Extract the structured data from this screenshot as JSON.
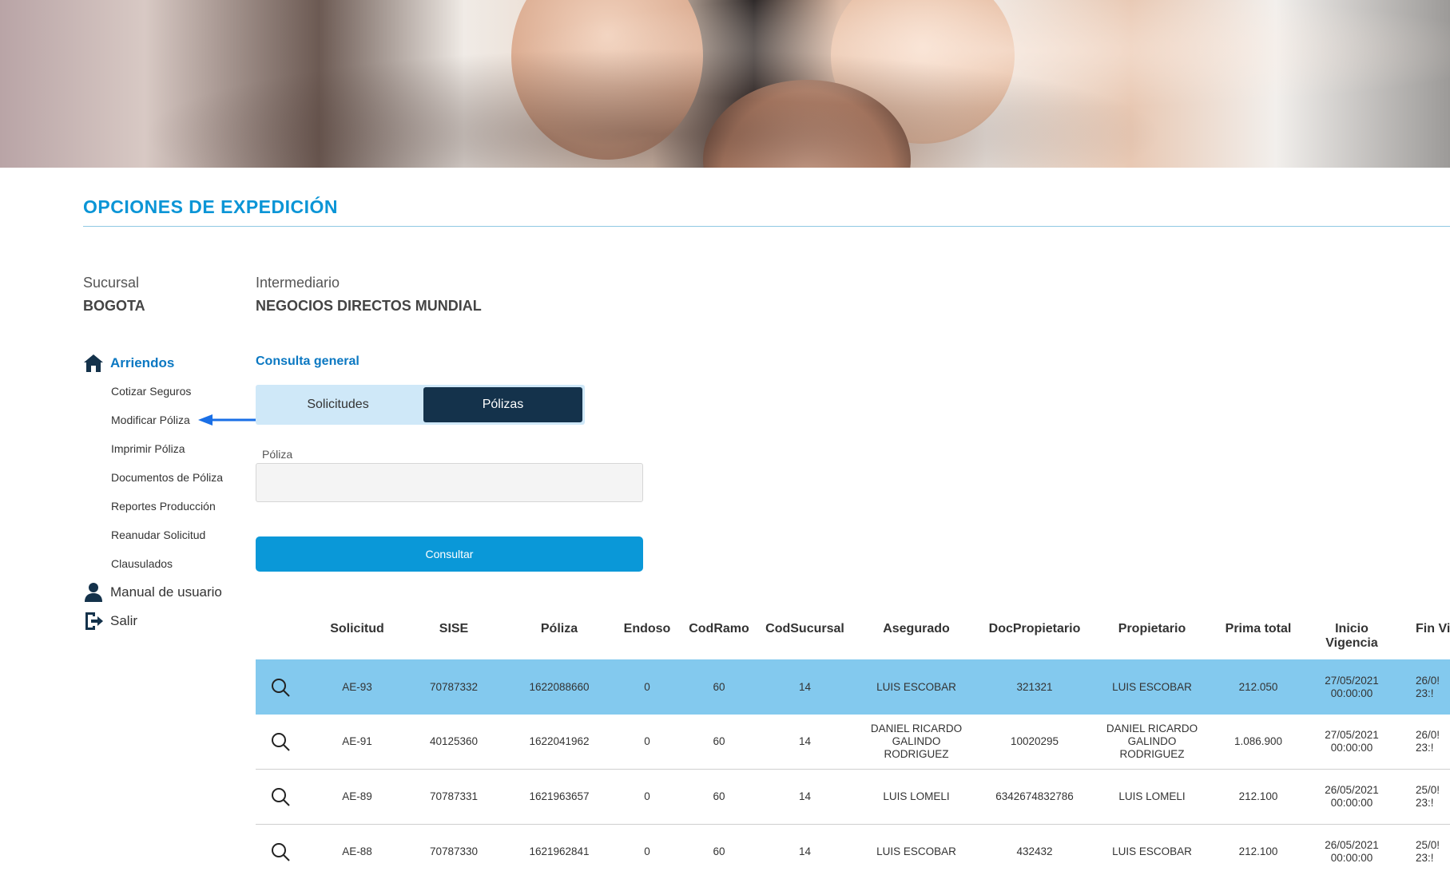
{
  "page": {
    "title": "OPCIONES DE EXPEDICIÓN"
  },
  "meta": {
    "sucursal_label": "Sucursal",
    "sucursal_value": "BOGOTA",
    "intermediario_label": "Intermediario",
    "intermediario_value": "NEGOCIOS DIRECTOS MUNDIAL"
  },
  "sidebar": {
    "section": {
      "label": "Arriendos",
      "icon": "home-icon"
    },
    "items": [
      {
        "label": "Cotizar Seguros"
      },
      {
        "label": "Modificar Póliza"
      },
      {
        "label": "Imprimir Póliza"
      },
      {
        "label": "Documentos de Póliza"
      },
      {
        "label": "Reportes Producción"
      },
      {
        "label": "Reanudar Solicitud"
      },
      {
        "label": "Clausulados"
      }
    ],
    "manual": {
      "label": "Manual de usuario",
      "icon": "user-icon"
    },
    "exit": {
      "label": "Salir",
      "icon": "logout-icon"
    }
  },
  "consulta": {
    "title": "Consulta general",
    "tabs": [
      {
        "label": "Solicitudes",
        "active": false
      },
      {
        "label": "Pólizas",
        "active": true
      }
    ],
    "field_label": "Póliza",
    "field_value": "",
    "button_label": "Consultar"
  },
  "table": {
    "headers": [
      "Solicitud",
      "SISE",
      "Póliza",
      "Endoso",
      "CodRamo",
      "CodSucursal",
      "Asegurado",
      "DocPropietario",
      "Propietario",
      "Prima total",
      "Inicio Vigencia",
      "Fin Vi"
    ],
    "rows": [
      {
        "selected": true,
        "cells": [
          "AE-93",
          "70787332",
          "1622088660",
          "0",
          "60",
          "14",
          "LUIS ESCOBAR",
          "321321",
          "LUIS ESCOBAR",
          "212.050",
          "27/05/2021 00:00:00",
          "26/0! 23:!"
        ]
      },
      {
        "selected": false,
        "cells": [
          "AE-91",
          "40125360",
          "1622041962",
          "0",
          "60",
          "14",
          "DANIEL RICARDO GALINDO RODRIGUEZ",
          "10020295",
          "DANIEL RICARDO GALINDO RODRIGUEZ",
          "1.086.900",
          "27/05/2021 00:00:00",
          "26/0! 23:!"
        ]
      },
      {
        "selected": false,
        "cells": [
          "AE-89",
          "70787331",
          "1621963657",
          "0",
          "60",
          "14",
          "LUIS LOMELI",
          "6342674832786",
          "LUIS LOMELI",
          "212.100",
          "26/05/2021 00:00:00",
          "25/0! 23:!"
        ]
      },
      {
        "selected": false,
        "cells": [
          "AE-88",
          "70787330",
          "1621962841",
          "0",
          "60",
          "14",
          "LUIS ESCOBAR",
          "432432",
          "LUIS ESCOBAR",
          "212.100",
          "26/05/2021 00:00:00",
          "25/0! 23:!"
        ]
      }
    ]
  },
  "colors": {
    "accent": "#0b95d6",
    "dark_tab": "#14324b",
    "selected_row": "#83c9ee",
    "annotation_arrow": "#1a6fe6"
  }
}
